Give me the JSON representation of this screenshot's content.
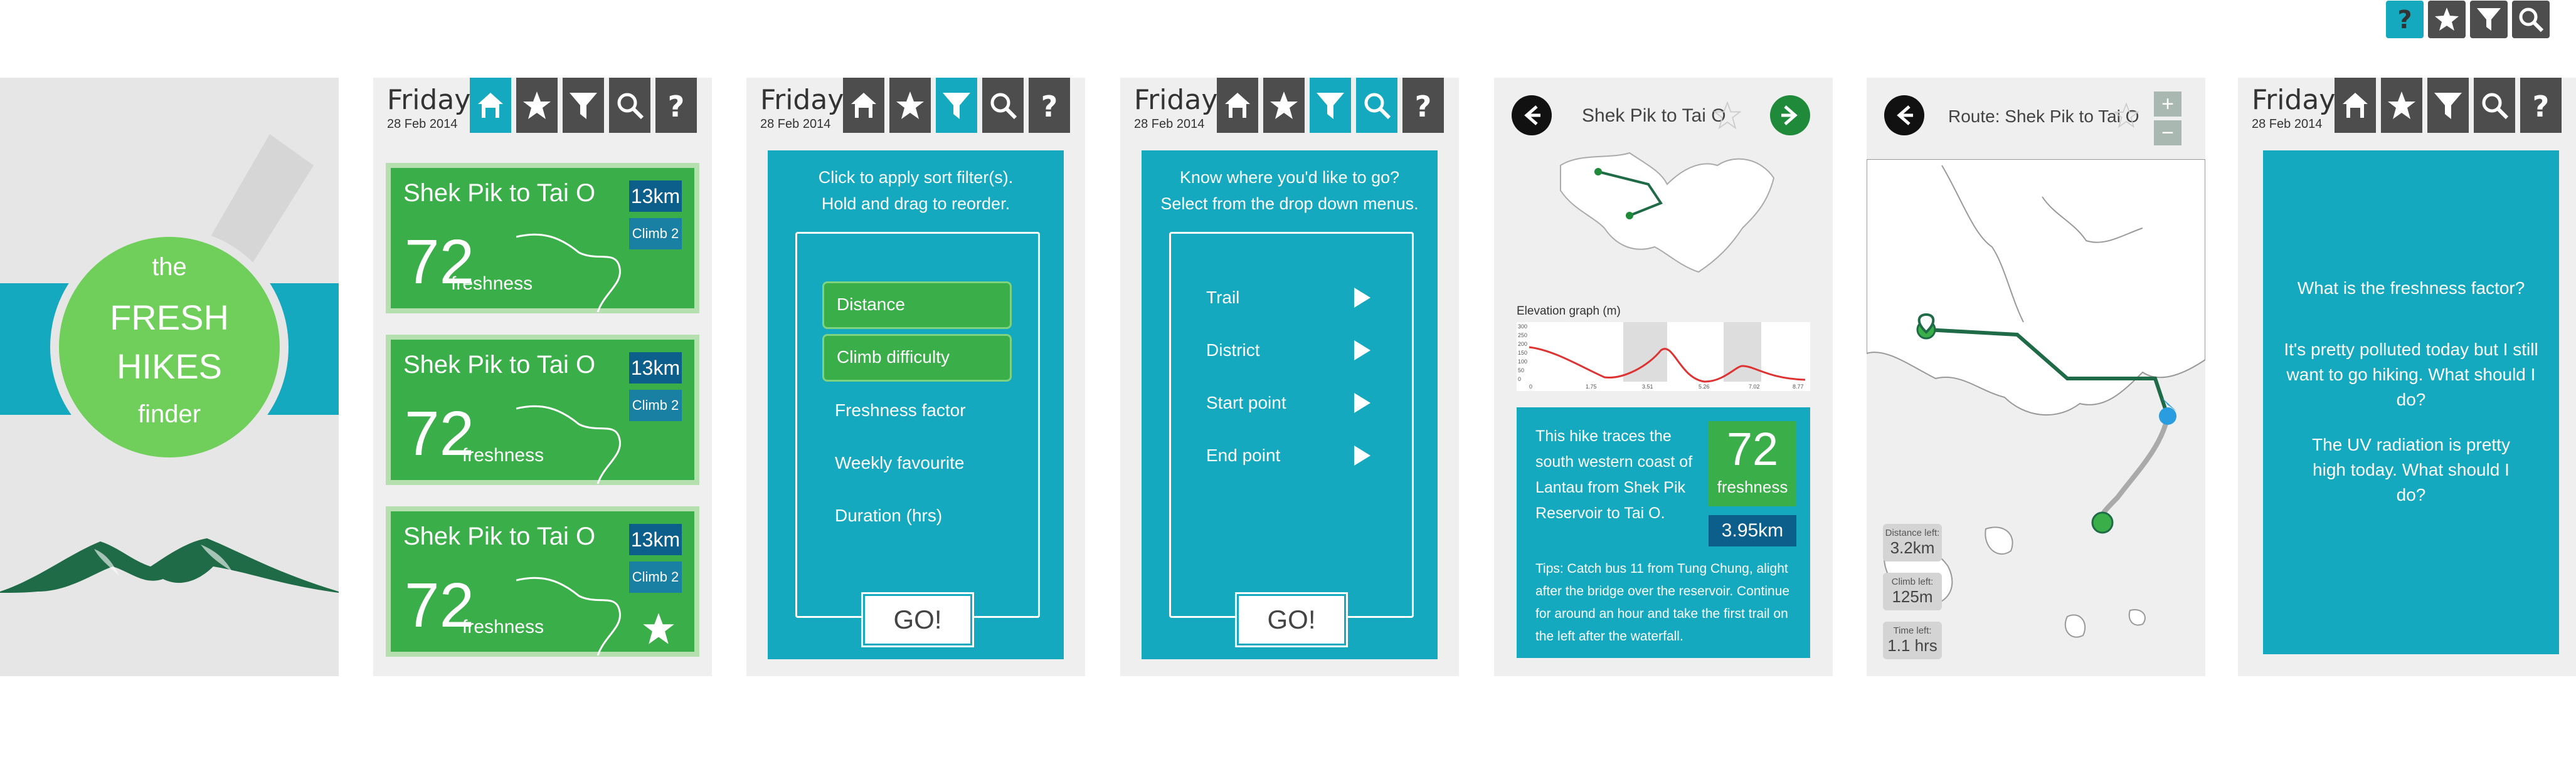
{
  "legend": {
    "icons": [
      "question-icon",
      "star-icon",
      "filter-icon",
      "search-icon"
    ]
  },
  "splash": {
    "the": "the",
    "fresh": "FRESH",
    "hikes": "HIKES",
    "finder": "finder"
  },
  "header": {
    "day": "Friday",
    "date": "28 Feb 2014",
    "nav_icons": [
      "home-icon",
      "star-icon",
      "filter-icon",
      "search-icon",
      "question-icon"
    ]
  },
  "list": {
    "cards": [
      {
        "title": "Shek Pik to Tai O",
        "freshness": "72",
        "freshness_label": "freshness",
        "distance": "13km",
        "climb": "Climb 2",
        "favourite": false
      },
      {
        "title": "Shek Pik to Tai O",
        "freshness": "72",
        "freshness_label": "freshness",
        "distance": "13km",
        "climb": "Climb 2",
        "favourite": false
      },
      {
        "title": "Shek Pik to Tai O",
        "freshness": "72",
        "freshness_label": "freshness",
        "distance": "13km",
        "climb": "Climb 2",
        "favourite": true
      }
    ]
  },
  "sort": {
    "instruction_1": "Click to apply sort filter(s).",
    "instruction_2": "Hold and drag to reorder.",
    "options": [
      "Distance",
      "Climb difficulty",
      "Freshness factor",
      "Weekly favourite",
      "Duration (hrs)"
    ],
    "selected": [
      true,
      true,
      false,
      false,
      false
    ],
    "go": "GO!"
  },
  "search": {
    "instruction_1": "Know where you'd like to go?",
    "instruction_2": "Select from the drop down menus.",
    "menus": [
      "Trail",
      "District",
      "Start point",
      "End point"
    ],
    "go": "GO!"
  },
  "detail": {
    "title": "Shek Pik to Tai O",
    "elevation_label": "Elevation graph (m)",
    "y_ticks": [
      "300",
      "250",
      "200",
      "150",
      "100",
      "50",
      "0"
    ],
    "x_ticks": [
      "0",
      "1.75",
      "3.51",
      "5.26",
      "7.02",
      "8.77"
    ],
    "description": "This hike traces the south western coast of Lantau from Shek Pik Reservoir to Tai O.",
    "freshness": "72",
    "freshness_label": "freshness",
    "distance": "3.95km",
    "tips": "Tips: Catch bus 11 from Tung Chung, alight after the bridge over the reservoir. Continue for around an hour and take the first trail on the left after the waterfall."
  },
  "route": {
    "title": "Route: Shek Pik to Tai O",
    "zoom_in": "+",
    "zoom_out": "−",
    "distance_left_label": "Distance left:",
    "distance_left": "3.2km",
    "climb_left_label": "Climb left:",
    "climb_left": "125m",
    "time_left_label": "Time left:",
    "time_left": "1.1 hrs"
  },
  "help": {
    "questions": [
      "What is the freshness factor?",
      "It's pretty polluted today but I still want to go hiking. What should I do?",
      "The UV radiation is pretty high today. What should I do?"
    ]
  },
  "colors": {
    "teal": "#14a9bf",
    "green": "#3aae48",
    "dark": "#4d4d4d",
    "navy": "#0b5f8a",
    "mountain": "#1f6b47"
  }
}
